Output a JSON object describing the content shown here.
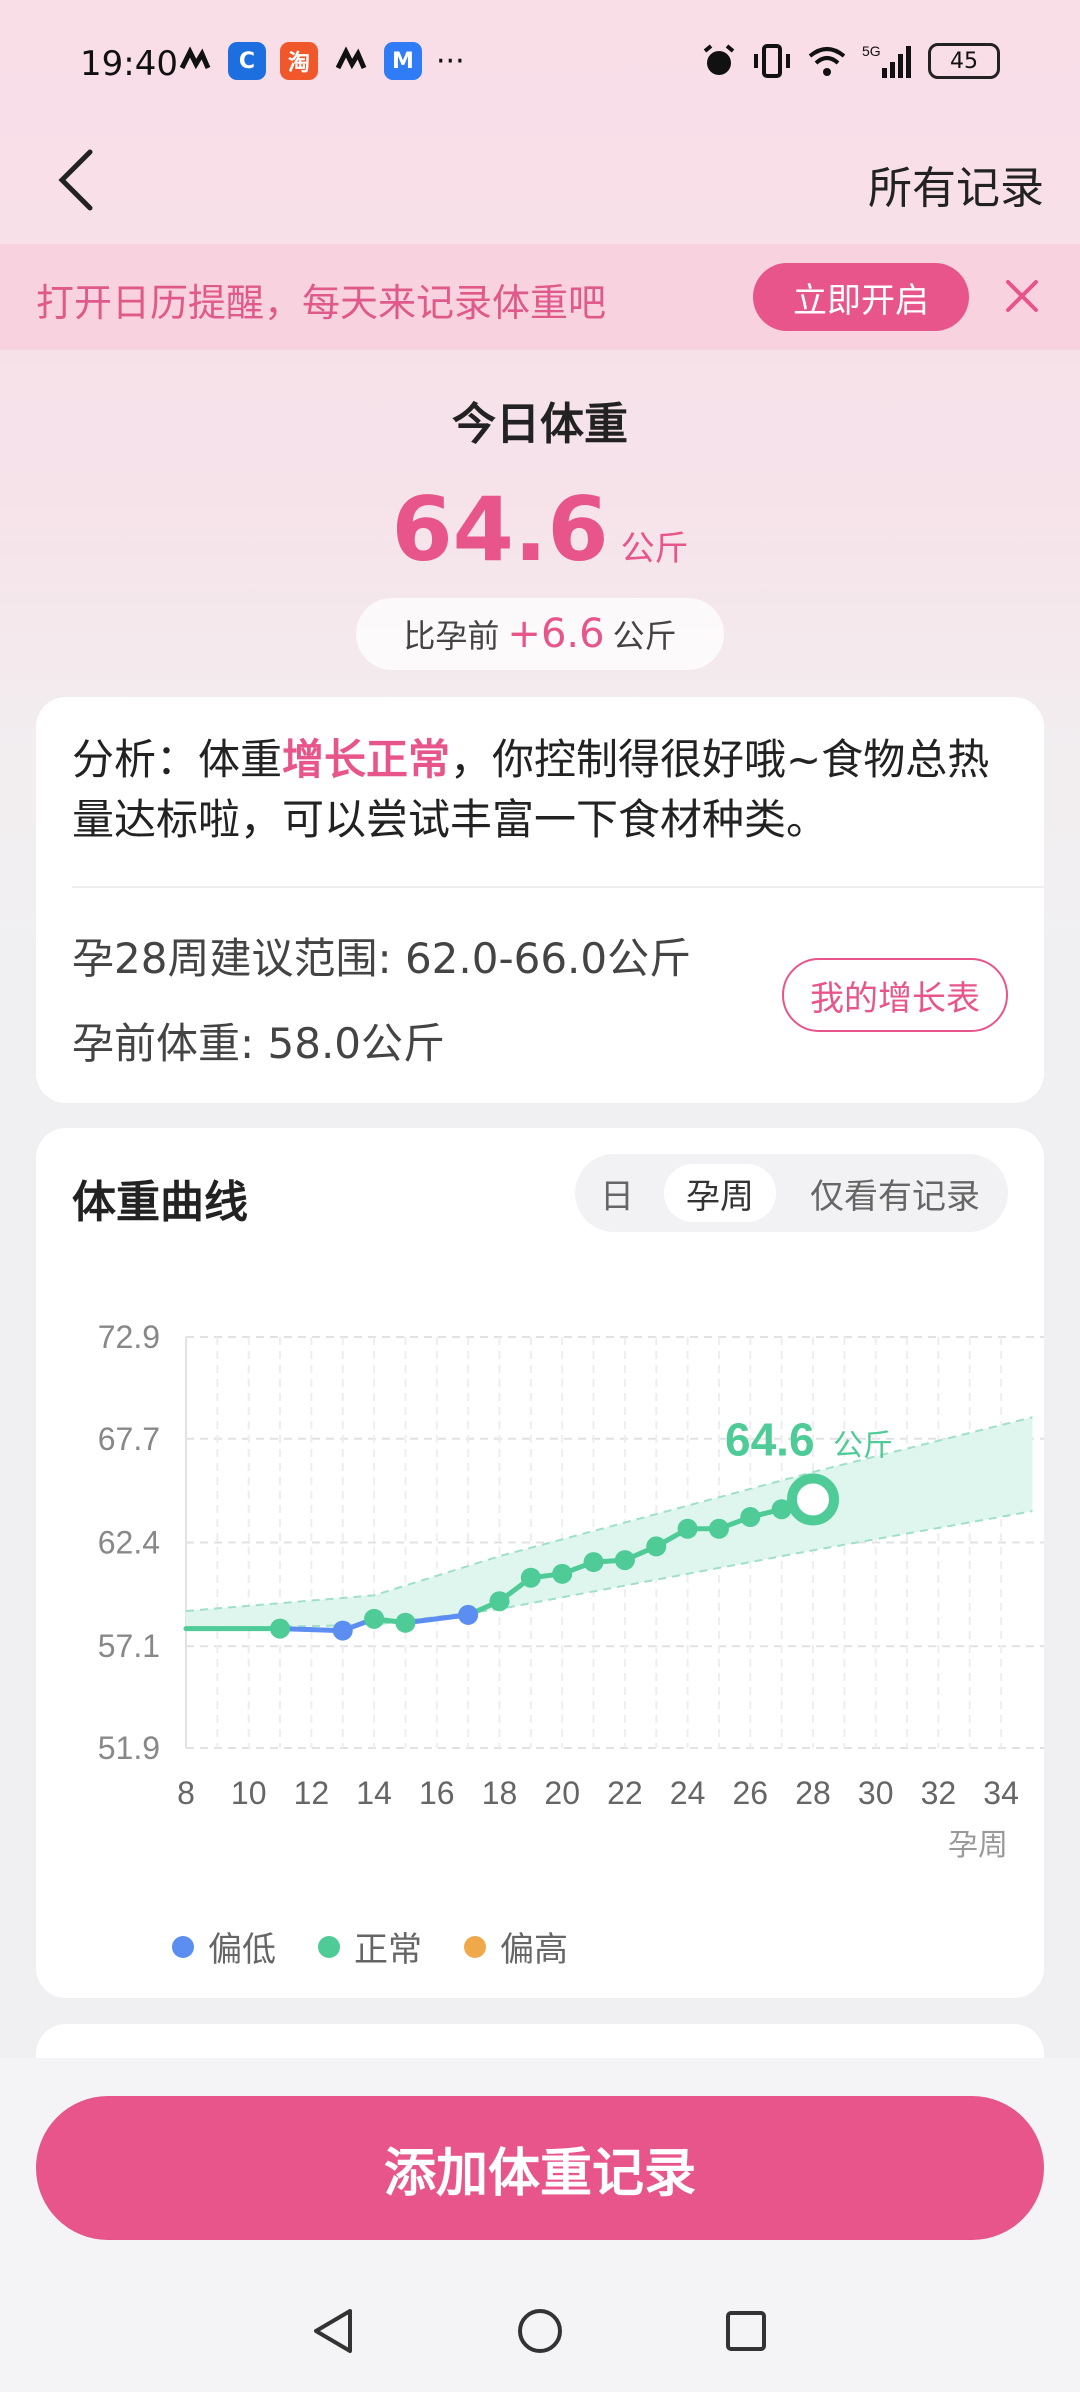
{
  "status": {
    "time": "19:40",
    "battery": "45",
    "icons_left": [
      "app-icon",
      "app-icon",
      "taobao-icon",
      "app-icon",
      "app-icon",
      "more-icon"
    ],
    "icons_right": [
      "alarm-icon",
      "vibrate-icon",
      "wifi-icon",
      "signal-5g-icon",
      "battery-icon"
    ]
  },
  "nav": {
    "all_records": "所有记录"
  },
  "banner": {
    "text": "打开日历提醒，每天来记录体重吧",
    "button": "立即开启"
  },
  "today": {
    "title": "今日体重",
    "weight": "64.6",
    "unit": "公斤",
    "compare_prefix": "比孕前",
    "compare_diff": "+6.6",
    "compare_unit": "公斤"
  },
  "analysis": {
    "prefix": "分析：体重",
    "highlight": "增长正常",
    "suffix": "，你控制得很好哦~食物总热量达标啦，可以尝试丰富一下食材种类。",
    "range": "孕28周建议范围: 62.0-66.0公斤",
    "pre_weight": "孕前体重: 58.0公斤",
    "growth_button": "我的增长表"
  },
  "chart_section": {
    "title": "体重曲线",
    "tabs": [
      "日",
      "孕周",
      "仅看有记录"
    ],
    "active_tab": "孕周",
    "latest_label": "64.6",
    "latest_unit": "公斤",
    "x_unit": "孕周",
    "legend": [
      {
        "label": "偏低",
        "color": "#5b8ef0"
      },
      {
        "label": "正常",
        "color": "#4ecb96"
      },
      {
        "label": "偏高",
        "color": "#f0a94a"
      }
    ]
  },
  "chart_data": {
    "type": "line",
    "xlabel": "孕周",
    "ylabel": "",
    "xlim": [
      8,
      35
    ],
    "ylim": [
      51.9,
      72.9
    ],
    "x_ticks": [
      8,
      10,
      12,
      14,
      16,
      18,
      20,
      22,
      24,
      26,
      28,
      30,
      32,
      34
    ],
    "y_ticks": [
      72.9,
      67.7,
      62.4,
      57.1,
      51.9
    ],
    "grid": true,
    "band": {
      "name": "建议范围",
      "x": [
        8,
        14,
        18,
        28,
        35
      ],
      "lower": [
        58.0,
        58.2,
        59.0,
        62.0,
        64.0
      ],
      "upper": [
        58.9,
        59.7,
        61.7,
        66.0,
        68.8
      ]
    },
    "series": [
      {
        "x": [
          8,
          11,
          13,
          14,
          15,
          17,
          18,
          19,
          20,
          21,
          22,
          23,
          24,
          25,
          26,
          27,
          28
        ],
        "values": [
          58.0,
          58.0,
          57.9,
          58.5,
          58.3,
          58.7,
          59.4,
          60.6,
          60.8,
          61.4,
          61.5,
          62.2,
          63.1,
          63.1,
          63.7,
          64.1,
          64.6
        ],
        "status": [
          "normal",
          "normal",
          "low",
          "normal",
          "normal",
          "low",
          "normal",
          "normal",
          "normal",
          "normal",
          "normal",
          "normal",
          "normal",
          "normal",
          "normal",
          "normal",
          "normal"
        ]
      }
    ]
  },
  "bottom": {
    "add_button": "添加体重记录"
  },
  "colors": {
    "accent": "#e8558a",
    "normal": "#4ecb96",
    "low": "#5b8ef0",
    "high": "#f0a94a"
  }
}
